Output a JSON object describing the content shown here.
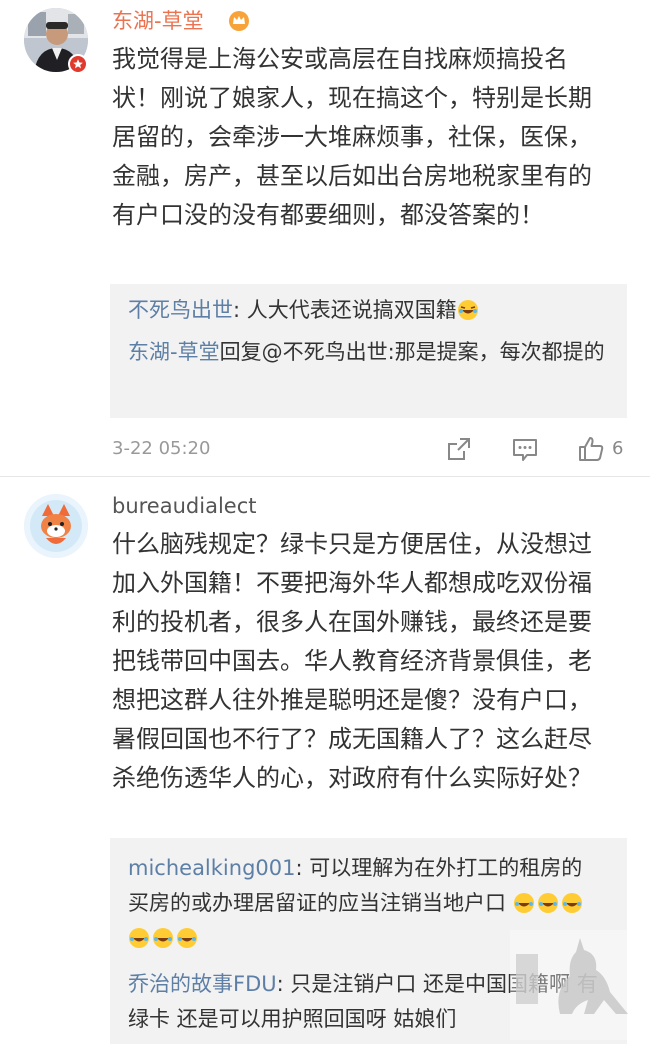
{
  "comments": [
    {
      "username": "东湖-草堂",
      "body": "我觉得是上海公安或高层在自找麻烦搞投名状！刚说了娘家人，现在搞这个，特别是长期居留的，会牵涉一大堆麻烦事，社保，医保，金融，房产，甚至以后如出台房地税家里有的有户口没的没有都要细则，都没答案的！",
      "replies": [
        {
          "name": "不死鸟出世",
          "text": ": 人大代表还说搞双国籍",
          "emoji": "laugh-cry-icon"
        },
        {
          "name": "东湖-草堂",
          "text": "回复@不死鸟出世:那是提案，每次都提的"
        }
      ],
      "time": "3-22 05:20",
      "likes": "6"
    },
    {
      "username": "bureaudialect",
      "body": "什么脑残规定？绿卡只是方便居住，从没想过加入外国籍！不要把海外华人都想成吃双份福利的投机者，很多人在国外赚钱，最终还是要把钱带回中国去。华人教育经济背景俱佳，老想把这群人往外推是聪明还是傻？没有户口，暑假回国也不行了？成无国籍人了？这么赶尽杀绝伤透华人的心，对政府有什么实际好处？",
      "replies": [
        {
          "name": "michealking001",
          "text": ": 可以理解为在外打工的租房的买房的或办理居留证的应当注销当地户口",
          "emoji_count": 6
        },
        {
          "name": "乔治的故事FDU",
          "text": ": 只是注销户口 还是中国国籍啊 有绿卡 还是可以用护照回国呀 姑娘们"
        }
      ]
    }
  ],
  "watermark": {
    "brand": "澳洲红袋鼠",
    "sub": "AUSTRALIA"
  }
}
